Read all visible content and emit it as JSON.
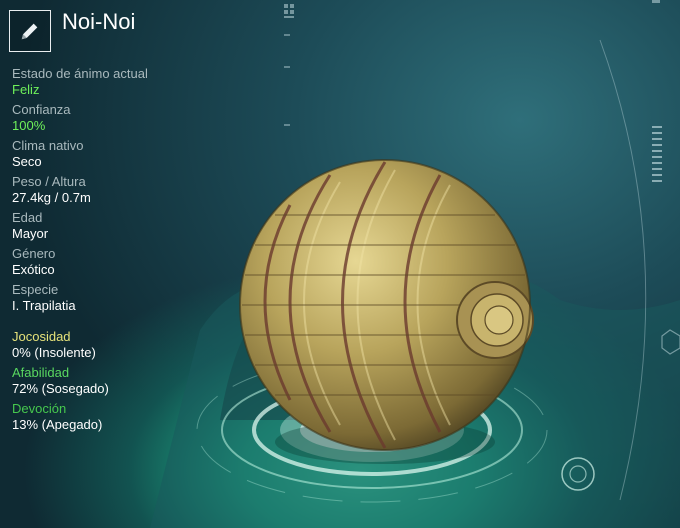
{
  "creature": {
    "name": "Noi-Noi"
  },
  "icons": {
    "edit": "pencil-icon"
  },
  "stats": [
    {
      "label": "Estado de ánimo actual",
      "value": "Feliz",
      "highlight": true
    },
    {
      "label": "Confianza",
      "value": "100%",
      "highlight": true
    },
    {
      "label": "Clima nativo",
      "value": "Seco",
      "highlight": false
    },
    {
      "label": "Peso / Altura",
      "value": "27.4kg / 0.7m",
      "highlight": false
    },
    {
      "label": "Edad",
      "value": "Mayor",
      "highlight": false
    },
    {
      "label": "Género",
      "value": "Exótico",
      "highlight": false
    },
    {
      "label": "Especie",
      "value": "I. Trapilatia",
      "highlight": false
    }
  ],
  "traits": [
    {
      "label": "Jocosidad",
      "value": "0% (Insolente)",
      "color": "#e6e27a"
    },
    {
      "label": "Afabilidad",
      "value": "72% (Sosegado)",
      "color": "#59d860"
    },
    {
      "label": "Devoción",
      "value": "13% (Apegado)",
      "color": "#46c84e"
    }
  ],
  "colors": {
    "background": "#163a44",
    "accent_glow": "#3fd6a6",
    "mood_green": "#6ef05a",
    "shell": "#b4a15a"
  }
}
